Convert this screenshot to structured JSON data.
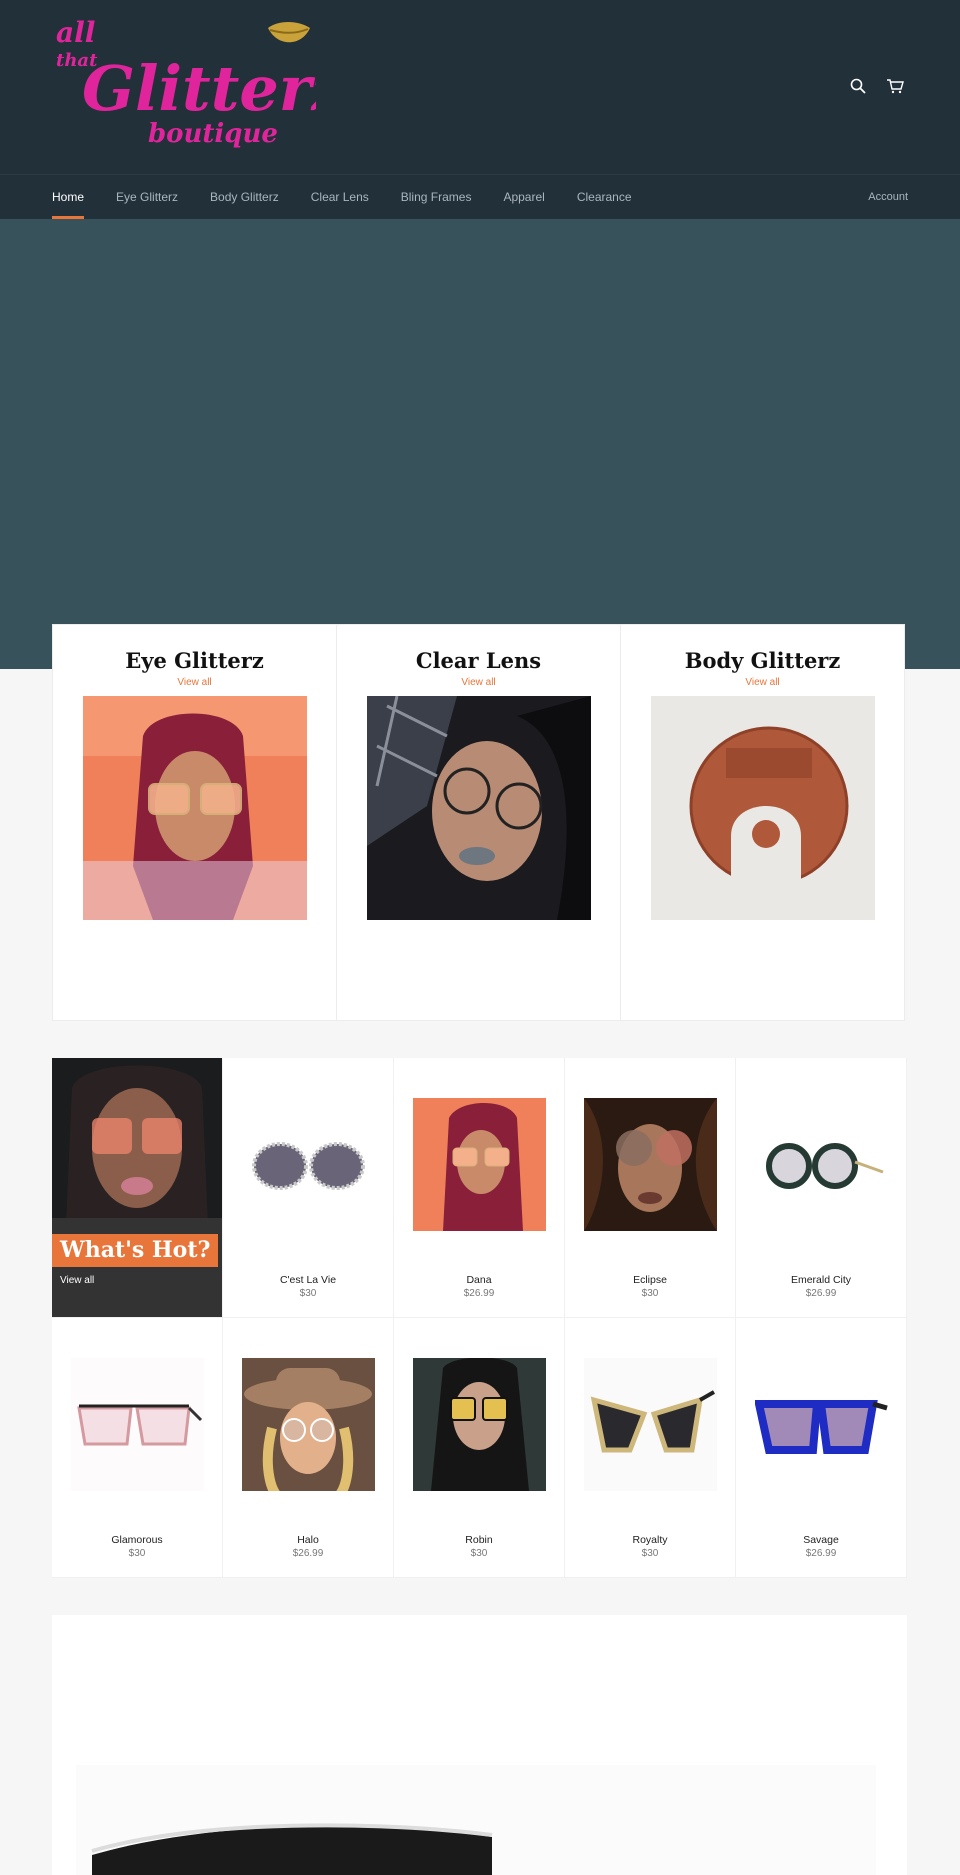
{
  "header": {
    "logo_alt": "all that Glitterz boutique",
    "icons": {
      "search": "search-icon",
      "cart": "cart-icon"
    }
  },
  "nav": {
    "items": [
      {
        "label": "Home",
        "active": true
      },
      {
        "label": "Eye Glitterz"
      },
      {
        "label": "Body Glitterz"
      },
      {
        "label": "Clear Lens"
      },
      {
        "label": "Bling Frames"
      },
      {
        "label": "Apparel"
      },
      {
        "label": "Clearance"
      }
    ],
    "account": "Account"
  },
  "collections": [
    {
      "title": "Eye Glitterz",
      "link": "View all"
    },
    {
      "title": "Clear Lens",
      "link": "View all"
    },
    {
      "title": "Body Glitterz",
      "link": "View all"
    }
  ],
  "hot": {
    "title": "What's Hot?",
    "link": "View all"
  },
  "products": [
    {
      "name": "C'est La Vie",
      "price": "$30"
    },
    {
      "name": "Dana",
      "price": "$26.99"
    },
    {
      "name": "Eclipse",
      "price": "$30"
    },
    {
      "name": "Emerald City",
      "price": "$26.99"
    },
    {
      "name": "Glamorous",
      "price": "$30"
    },
    {
      "name": "Halo",
      "price": "$26.99"
    },
    {
      "name": "Robin",
      "price": "$30"
    },
    {
      "name": "Royalty",
      "price": "$30"
    },
    {
      "name": "Savage",
      "price": "$26.99"
    }
  ],
  "colors": {
    "header_bg": "#22303a",
    "hero_bg": "#37525b",
    "accent": "#e8763a",
    "logo_pink": "#e0249b",
    "logo_gold": "#c9a23a"
  }
}
